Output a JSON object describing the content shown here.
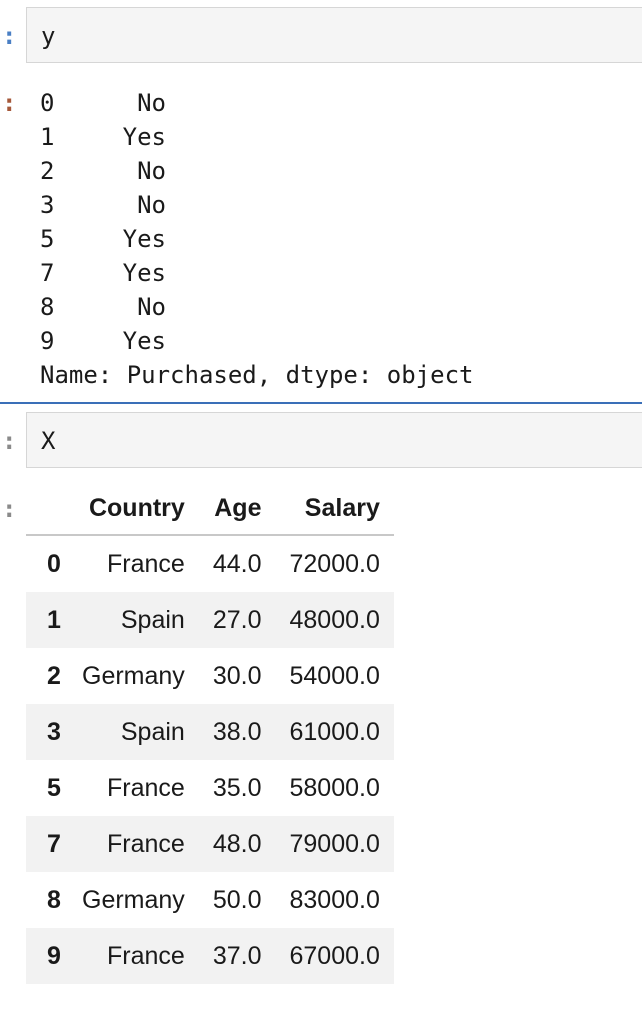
{
  "cells": [
    {
      "in_prompt": ":",
      "code": "y",
      "out_prompt": ":",
      "series": {
        "rows": [
          {
            "index": "0",
            "value": "No"
          },
          {
            "index": "1",
            "value": "Yes"
          },
          {
            "index": "2",
            "value": "No"
          },
          {
            "index": "3",
            "value": "No"
          },
          {
            "index": "5",
            "value": "Yes"
          },
          {
            "index": "7",
            "value": "Yes"
          },
          {
            "index": "8",
            "value": "No"
          },
          {
            "index": "9",
            "value": "Yes"
          }
        ],
        "footer": "Name: Purchased, dtype: object"
      }
    },
    {
      "in_prompt": ":",
      "code": "X",
      "out_prompt": ":",
      "dataframe": {
        "columns": [
          "Country",
          "Age",
          "Salary"
        ],
        "rows": [
          {
            "index": "0",
            "values": [
              "France",
              "44.0",
              "72000.0"
            ]
          },
          {
            "index": "1",
            "values": [
              "Spain",
              "27.0",
              "48000.0"
            ]
          },
          {
            "index": "2",
            "values": [
              "Germany",
              "30.0",
              "54000.0"
            ]
          },
          {
            "index": "3",
            "values": [
              "Spain",
              "38.0",
              "61000.0"
            ]
          },
          {
            "index": "5",
            "values": [
              "France",
              "35.0",
              "58000.0"
            ]
          },
          {
            "index": "7",
            "values": [
              "France",
              "48.0",
              "79000.0"
            ]
          },
          {
            "index": "8",
            "values": [
              "Germany",
              "50.0",
              "83000.0"
            ]
          },
          {
            "index": "9",
            "values": [
              "France",
              "37.0",
              "67000.0"
            ]
          }
        ]
      }
    }
  ],
  "colors": {
    "active_cell_accent": "#3a6fb8",
    "in_prompt_active": "#4a7fc4",
    "out_prompt": "#a5583a",
    "in_prompt_inactive": "#8a8a8a"
  }
}
